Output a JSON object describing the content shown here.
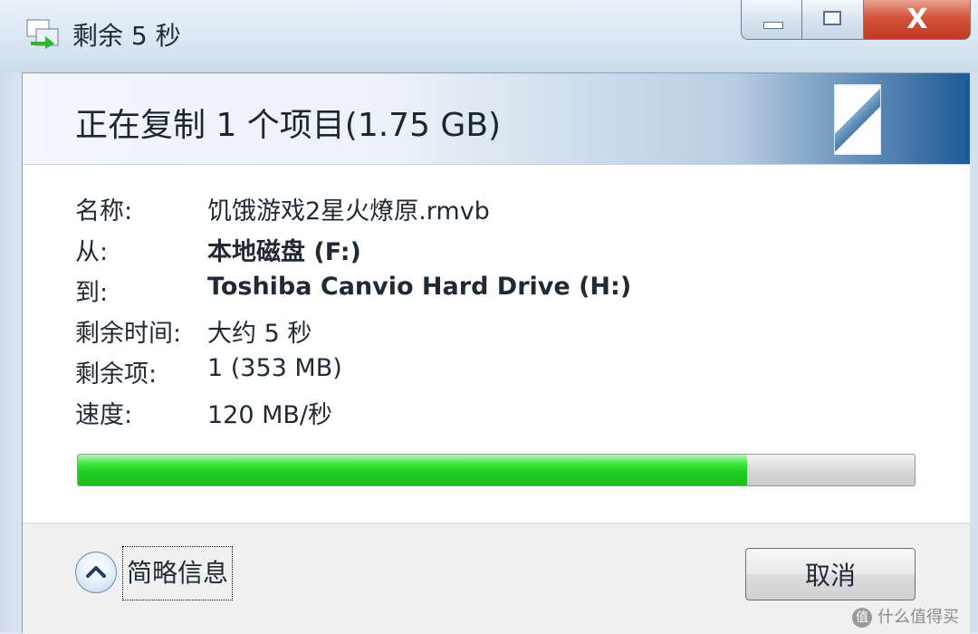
{
  "window": {
    "title": "剩余 5 秒",
    "close_glyph": "X",
    "icons": {
      "app": "file-copy-icon"
    }
  },
  "banner": {
    "title": "正在复制 1 个项目(1.75 GB)"
  },
  "details": [
    {
      "label": "名称:",
      "value": "饥饿游戏2星火燎原.rmvb",
      "bold": false
    },
    {
      "label": "从:",
      "value": "本地磁盘 (F:)",
      "bold": true
    },
    {
      "label": "到:",
      "value": "Toshiba Canvio Hard Drive (H:)",
      "bold": true
    },
    {
      "label": "剩余时间:",
      "value": "大约 5 秒",
      "bold": false
    },
    {
      "label": "剩余项:",
      "value": "1 (353 MB)",
      "bold": false
    },
    {
      "label": "速度:",
      "value": "120 MB/秒",
      "bold": false
    }
  ],
  "progress": {
    "percent": 80,
    "color": "#22cc22"
  },
  "footer": {
    "details_toggle_label": "简略信息",
    "cancel_label": "取消"
  },
  "watermark": {
    "badge": "值",
    "text": "什么值得买"
  }
}
